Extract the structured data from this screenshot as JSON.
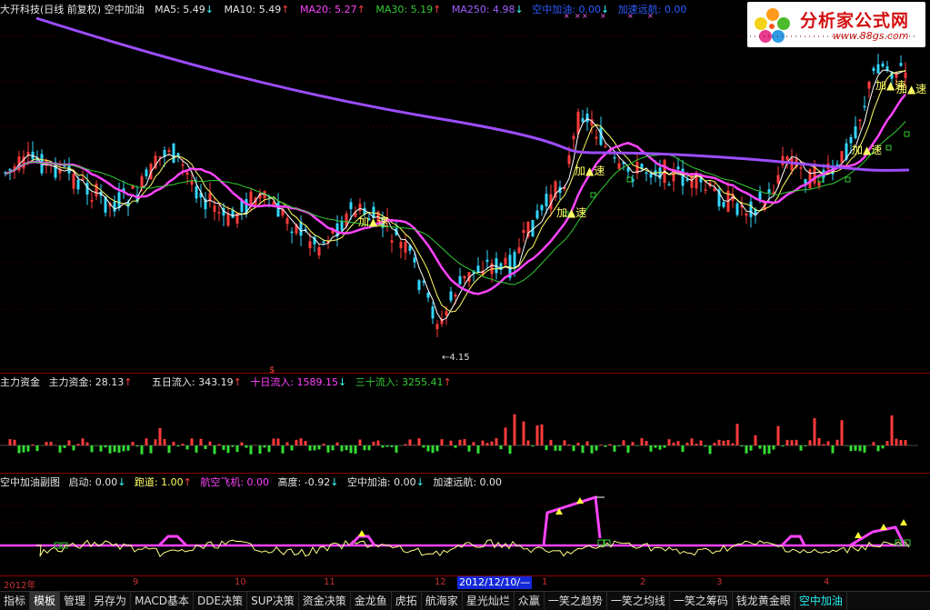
{
  "main_legend": {
    "stock": "大开科技(日线 前复权) 空中加油",
    "ma5": "MA5: 5.49",
    "ma10": "MA10: 5.49",
    "ma20": "MA20: 5.27",
    "ma30": "MA30: 5.19",
    "ma250": "MA250: 4.98",
    "kzjy": "空中加油: 0.00",
    "jsyh": "加速远航: 0.00"
  },
  "main_annotations": {
    "low_price": "4.15",
    "dollar": "$",
    "accel_label": "加▲速"
  },
  "fund_legend": {
    "title": "主力资金",
    "main": "主力资金: 28.13",
    "five_day": "五日流入: 343.19",
    "ten_day": "十日流入: 1589.15",
    "thirty_day": "三十流入: 3255.41"
  },
  "sub_legend": {
    "title": "空中加油副图",
    "start": "启动: 0.00",
    "runway": "跑道: 1.00",
    "aircraft": "航空飞机: 0.00",
    "height": "高度: -0.92",
    "kzjy": "空中加油: 0.00",
    "cruise": "加速远航: 0.00"
  },
  "logo": {
    "name": "分析家公式网",
    "url": "www.88gs.com"
  },
  "xaxis": {
    "year": "2012年",
    "months": [
      "9",
      "10",
      "11",
      "12",
      "1",
      "2",
      "3",
      "4"
    ],
    "cursor_date": "2012/12/10/—"
  },
  "tabs": [
    "指标",
    "模板",
    "管理",
    "另存为",
    "MACD基本",
    "DDE决策",
    "SUP决策",
    "资金决策",
    "金龙鱼",
    "虎拓",
    "航海家",
    "星光灿烂",
    "众赢",
    "一笑之趋势",
    "一笑之均线",
    "一笑之筹码",
    "钱龙黄金眼",
    "空中加油"
  ],
  "colors": {
    "up": "#ff3b3b",
    "down": "#33d6ff",
    "ma5": "#ffffff",
    "ma10": "#ffff66",
    "ma20": "#ff44ff",
    "ma30": "#33cc33",
    "ma250": "#9c4dff",
    "grid": "#8b0000"
  }
}
